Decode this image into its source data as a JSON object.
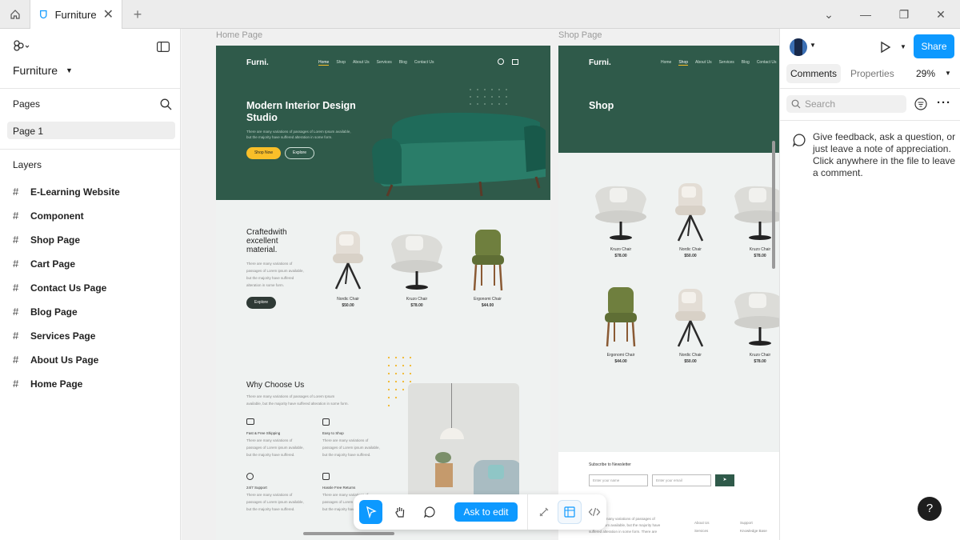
{
  "tab": {
    "title": "Furniture"
  },
  "left": {
    "file_name": "Furniture",
    "pages_label": "Pages",
    "page": "Page 1",
    "layers_label": "Layers",
    "layers": [
      "E-Learning Website",
      "Component",
      "Shop Page",
      "Cart Page",
      "Contact Us Page",
      "Blog Page",
      "Services Page",
      "About Us Page",
      "Home Page"
    ]
  },
  "canvas": {
    "frame1_label": "Home Page",
    "frame2_label": "Shop Page",
    "home": {
      "logo": "Furni.",
      "nav": [
        "Home",
        "Shop",
        "About Us",
        "Services",
        "Blog",
        "Contact Us"
      ],
      "hero_title_1": "Modern Interior Design",
      "hero_title_2": "Studio",
      "hero_text_1": "There are many variations of passages of Lorem Ipsum available,",
      "hero_text_2": "but the majority have suffered alteration in some form.",
      "shop_now": "Shop Now",
      "explore": "Explore",
      "crafted_1": "Craftedwith",
      "crafted_2": "excellent",
      "crafted_3": "material.",
      "crafted_text_1": "There are many variations of",
      "crafted_text_2": "passages of Lorem ipsum available,",
      "crafted_text_3": "but the majority have suffered",
      "crafted_text_4": "alteration in some form.",
      "crafted_btn": "Explore",
      "products": [
        {
          "name": "Nordic Chair",
          "price": "$50.00"
        },
        {
          "name": "Kruzo Chair",
          "price": "$78.00"
        },
        {
          "name": "Ergonomi Chair",
          "price": "$44.00"
        }
      ],
      "why_title": "Why Choose Us",
      "why_text_1": "There are many variations of passages of Lorem Ipsum",
      "why_text_2": "available, but the majority have suffered alteration in some form.",
      "features": [
        {
          "title": "Fast & Free Shipping",
          "l1": "There are many variations of",
          "l2": "passages of Lorem ipsum available,",
          "l3": "but the majority have suffered."
        },
        {
          "title": "Easy to Shop",
          "l1": "There are many variations of",
          "l2": "passages of Lorem ipsum available,",
          "l3": "but the majority have suffered."
        },
        {
          "title": "24/7 Support",
          "l1": "There are many variations of",
          "l2": "passages of Lorem ipsum available,",
          "l3": "but the majority have suffered."
        },
        {
          "title": "Hassle Free Returns",
          "l1": "There are many variations of",
          "l2": "passages of Lorem ipsum available,",
          "l3": "but the majority have suffered."
        }
      ]
    },
    "shop": {
      "logo": "Furni.",
      "nav": [
        "Home",
        "Shop",
        "About Us",
        "Services",
        "Blog",
        "Contact Us"
      ],
      "title": "Shop",
      "products": [
        {
          "name": "Kruzo Chair",
          "price": "$78.00"
        },
        {
          "name": "Nordic Chair",
          "price": "$50.00"
        },
        {
          "name": "Kruzo Chair",
          "price": "$78.00"
        },
        {
          "name": "Ergonomi Chair",
          "price": "$44.00"
        },
        {
          "name": "Nordic Chair",
          "price": "$50.00"
        },
        {
          "name": "Kruzo Chair",
          "price": "$78.00"
        }
      ],
      "newsletter": "Subscribe to Newsletter",
      "name_placeholder": "Enter your name",
      "email_placeholder": "Enter your email",
      "footer_logo": "i.",
      "footer_text_1": "There are many variations of passages of",
      "footer_text_2": "Lorem ipsum available, but the majority have",
      "footer_text_3": "suffered alteration in some form. There are",
      "footer_links": [
        "About Us",
        "Support",
        "Services",
        "Knowledge Base"
      ]
    }
  },
  "right": {
    "tab_comments": "Comments",
    "tab_properties": "Properties",
    "zoom": "29%",
    "share": "Share",
    "search_placeholder": "Search",
    "empty_1": "Give feedback, ask a question, or",
    "empty_2": "just leave a note of appreciation.",
    "empty_3": "Click anywhere in the file to leave",
    "empty_4": "a comment."
  },
  "toolbar": {
    "ask_label": "Ask to edit"
  },
  "help": {
    "label": "?"
  },
  "colors": {
    "accent": "#0d99ff",
    "brand_green": "#2f5a4a",
    "yellow": "#f9bf29"
  }
}
